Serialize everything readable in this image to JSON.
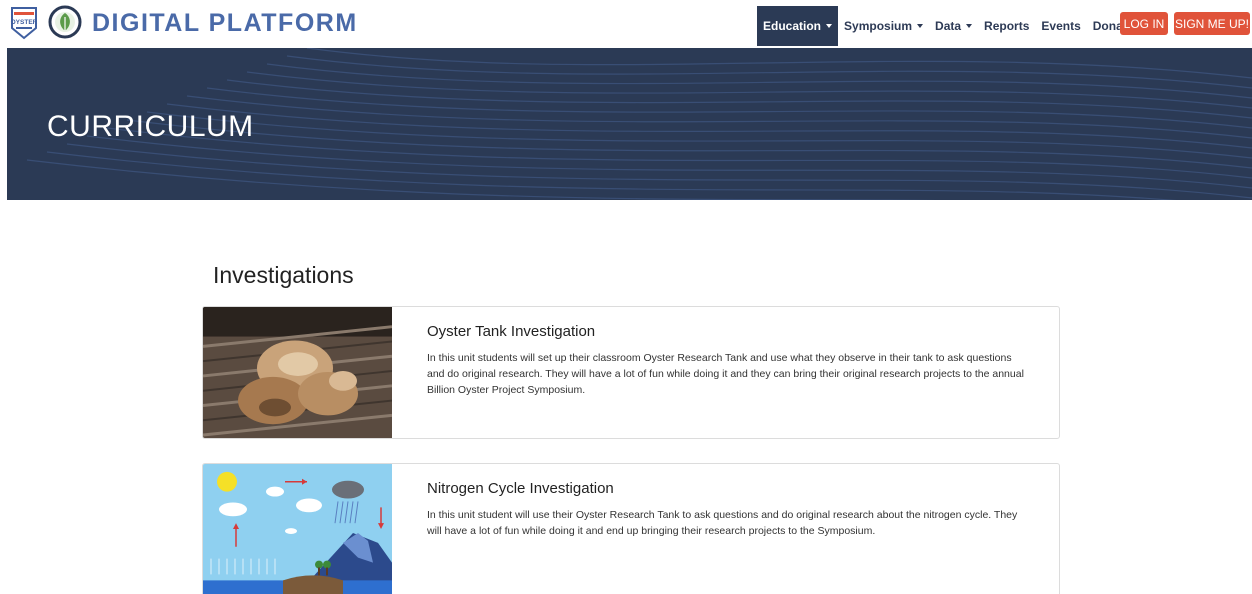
{
  "brand": {
    "name": "DIGITAL PLATFORM",
    "badge_text": "OYSTER"
  },
  "nav": {
    "items": [
      {
        "label": "Education",
        "dropdown": true,
        "active": true
      },
      {
        "label": "Symposium",
        "dropdown": true
      },
      {
        "label": "Data",
        "dropdown": true
      },
      {
        "label": "Reports"
      },
      {
        "label": "Events"
      },
      {
        "label": "Donate"
      }
    ],
    "login_label": "LOG IN",
    "signup_label": "SIGN ME UP!"
  },
  "hero": {
    "title": "CURRICULUM"
  },
  "section": {
    "title": "Investigations",
    "cards": [
      {
        "title": "Oyster Tank Investigation",
        "text": "In this unit students will set up their classroom Oyster Research Tank and use what they observe in their tank to ask questions and do original research. They will have a lot of fun while doing it and they can bring their original research projects to the annual Billion Oyster Project Symposium."
      },
      {
        "title": "Nitrogen Cycle Investigation",
        "text": "In this unit student will use their Oyster Research Tank to ask questions and do original research about the nitrogen cycle. They will have a lot of fun while doing it and end up bringing their research projects to the Symposium."
      }
    ]
  },
  "colors": {
    "navy": "#2b3a55",
    "brand_blue": "#4a6aa8",
    "accent_red": "#e0533a"
  }
}
